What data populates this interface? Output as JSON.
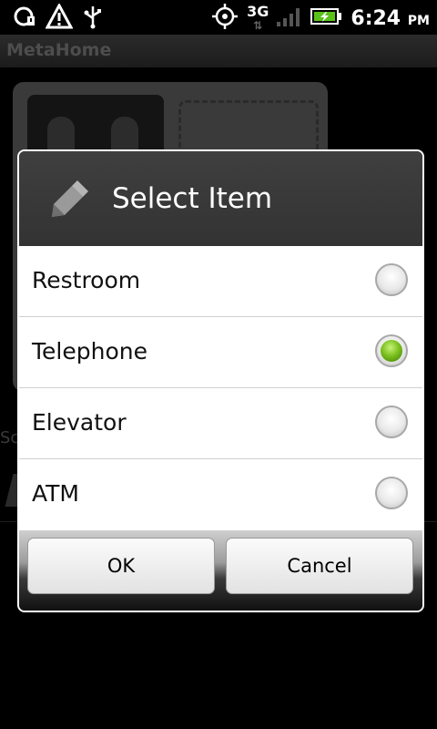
{
  "status_bar": {
    "time": "6:24",
    "ampm": "PM",
    "network": "3G",
    "icons": [
      "sync-alert-icon",
      "warning-icon",
      "usb-icon",
      "gps-icon",
      "network-3g-icon",
      "signal-icon",
      "battery-charging-icon"
    ]
  },
  "app": {
    "title": "MetaHome"
  },
  "background": {
    "partial_text": "Sc"
  },
  "dialog": {
    "title": "Select Item",
    "icon": "pencil-icon",
    "items": [
      {
        "label": "Restroom",
        "selected": false
      },
      {
        "label": "Telephone",
        "selected": true
      },
      {
        "label": "Elevator",
        "selected": false
      },
      {
        "label": "ATM",
        "selected": false
      }
    ],
    "ok_label": "OK",
    "cancel_label": "Cancel"
  },
  "colors": {
    "accent_selected": "#7cc21f",
    "title_text": "#ffffff",
    "list_bg": "#ffffff"
  }
}
